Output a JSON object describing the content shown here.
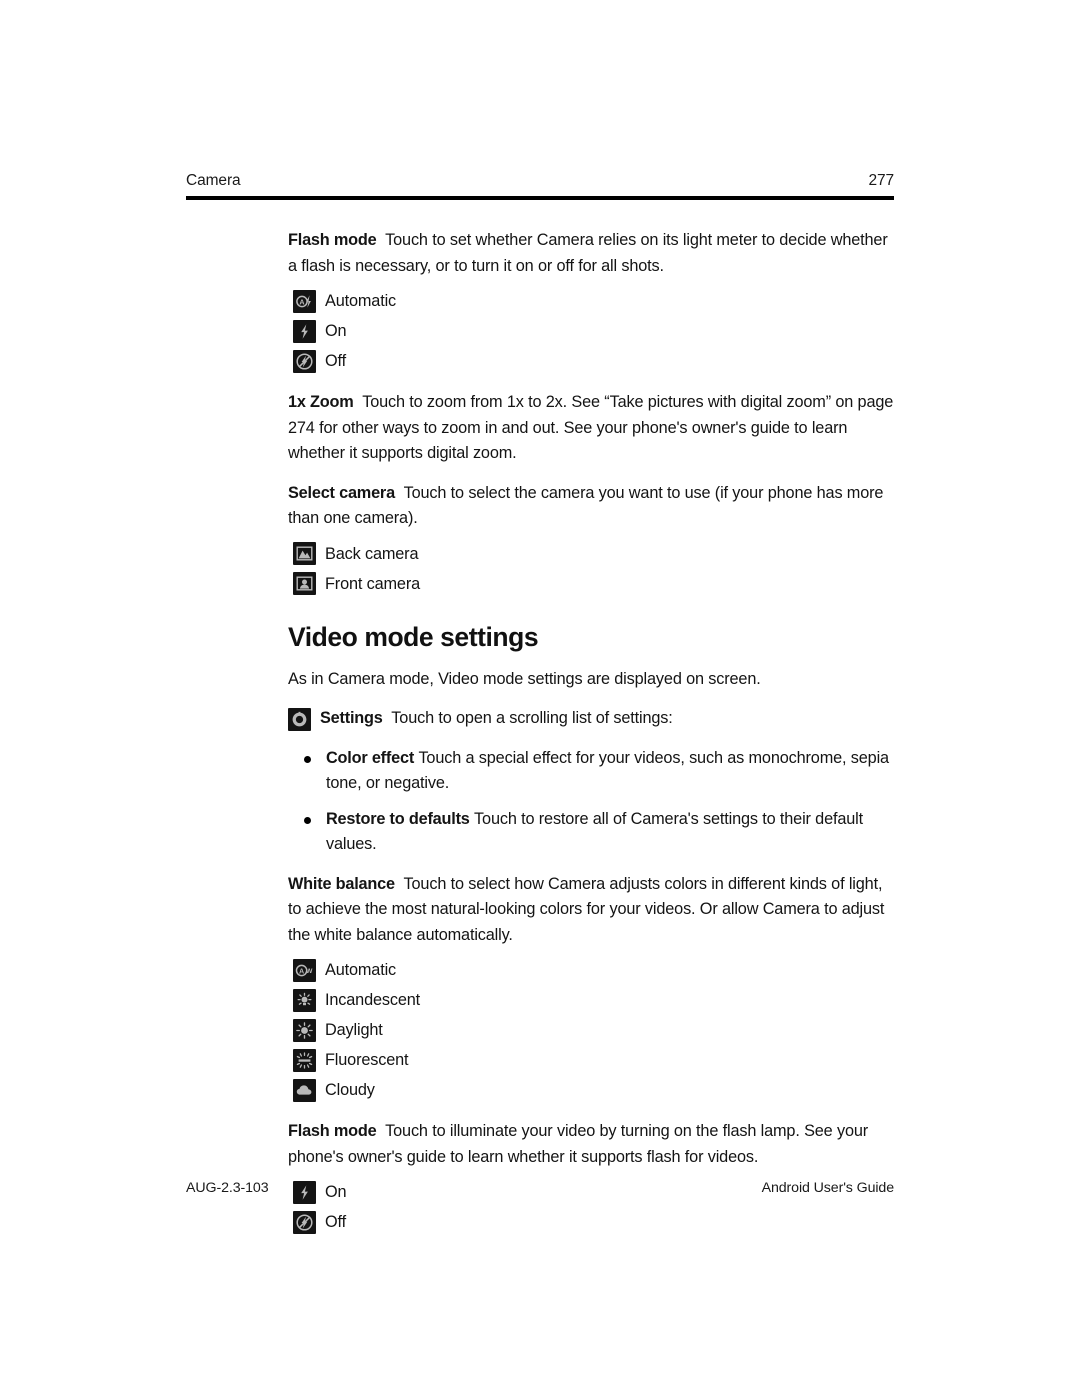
{
  "header": {
    "running_head": "Camera",
    "page_number": "277"
  },
  "footer": {
    "doc_code": "AUG-2.3-103",
    "doc_title": "Android User's Guide"
  },
  "content": {
    "flash_mode_camera": {
      "lead": "Flash mode",
      "body": "Touch to set whether Camera relies on its light meter to decide whether a flash is necessary, or to turn it on or off for all shots.",
      "options": [
        {
          "icon": "flash-auto-icon",
          "label": "Automatic"
        },
        {
          "icon": "flash-on-icon",
          "label": "On"
        },
        {
          "icon": "flash-off-icon",
          "label": "Off"
        }
      ]
    },
    "zoom": {
      "lead": "1x Zoom",
      "body": "Touch to zoom from 1x to 2x. See “Take pictures with digital zoom” on page 274 for other ways to zoom in and out. See your phone's owner's guide to learn whether it supports digital zoom."
    },
    "select_camera": {
      "lead": "Select camera",
      "body": "Touch to select the camera you want to use (if your phone has more than one camera).",
      "options": [
        {
          "icon": "back-camera-icon",
          "label": "Back camera"
        },
        {
          "icon": "front-camera-icon",
          "label": "Front camera"
        }
      ]
    },
    "video_mode_settings": {
      "title": "Video mode settings",
      "intro": "As in Camera mode, Video mode settings are displayed on screen.",
      "settings": {
        "icon": "settings-gear-icon",
        "lead": "Settings",
        "body": "Touch to open a scrolling list of settings:"
      },
      "bullets": [
        {
          "lead": "Color effect",
          "body": "Touch a special effect for your videos, such as monochrome, sepia tone, or negative."
        },
        {
          "lead": "Restore to defaults",
          "body": "Touch to restore all of Camera's settings to their default values."
        }
      ]
    },
    "white_balance": {
      "lead": "White balance",
      "body": "Touch to select how Camera adjusts colors in different kinds of light, to achieve the most natural-looking colors for your videos. Or allow Camera to adjust the white balance automatically.",
      "options": [
        {
          "icon": "white-balance-auto-icon",
          "label": "Automatic"
        },
        {
          "icon": "incandescent-icon",
          "label": "Incandescent"
        },
        {
          "icon": "daylight-icon",
          "label": "Daylight"
        },
        {
          "icon": "fluorescent-icon",
          "label": "Fluorescent"
        },
        {
          "icon": "cloudy-icon",
          "label": "Cloudy"
        }
      ]
    },
    "flash_mode_video": {
      "lead": "Flash mode",
      "body": "Touch to illuminate your video by turning on the flash lamp. See your phone's owner's guide to learn whether it supports flash for videos.",
      "options": [
        {
          "icon": "flash-on-icon",
          "label": "On"
        },
        {
          "icon": "flash-off-icon",
          "label": "Off"
        }
      ]
    }
  },
  "colors": {
    "icon_background": "#141414",
    "icon_glyph": "#b4b4b4",
    "text": "#141414",
    "rule": "#000000"
  }
}
